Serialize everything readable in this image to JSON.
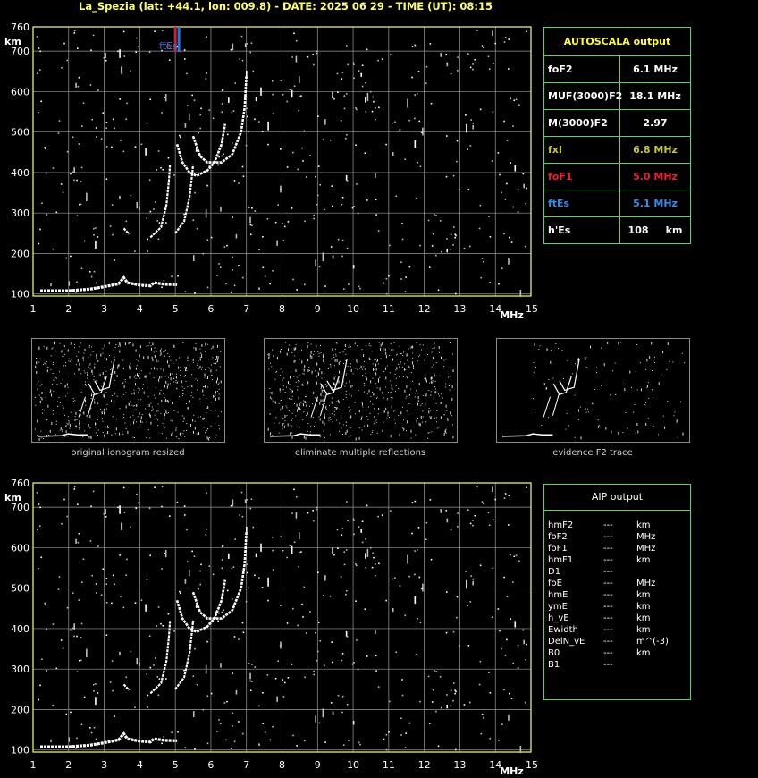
{
  "header": {
    "title": "La_Spezia (lat: +44.1, lon: 009.8) - DATE: 2025 06 29 - TIME (UT): 08:15"
  },
  "ionogram": {
    "y_label": "km",
    "x_label": "MHz",
    "y_ticks": [
      "760",
      "700",
      "600",
      "500",
      "400",
      "300",
      "200",
      "100"
    ],
    "x_ticks": [
      "1",
      "2",
      "3",
      "4",
      "5",
      "6",
      "7",
      "8",
      "9",
      "10",
      "11",
      "12",
      "13",
      "14",
      "15"
    ],
    "marker_label_fo": "fo",
    "marker_label_ftes": "ftEs",
    "colors": {
      "frame": "#ffff66",
      "grid": "#9a9a9a",
      "trace": "#ffffff",
      "fof1_marker": "#d21f2f",
      "ftes_marker": "#1f7be0"
    }
  },
  "autoscala": {
    "title": "AUTOSCALA output",
    "rows": [
      {
        "label": "foF2",
        "value": "6.1 MHz",
        "color": "#ffffff"
      },
      {
        "label": "MUF(3000)F2",
        "value": "18.1 MHz",
        "color": "#ffffff"
      },
      {
        "label": "M(3000)F2",
        "value": "2.97",
        "color": "#ffffff"
      },
      {
        "label": "fxI",
        "value": "6.8 MHz",
        "color": "#c8c832"
      },
      {
        "label": "foF1",
        "value": "5.0 MHz",
        "color": "#e8202f"
      },
      {
        "label": "ftEs",
        "value": "5.1 MHz",
        "color": "#2f8cf0"
      },
      {
        "label": "h'Es",
        "value": "108     km",
        "color": "#ffffff"
      }
    ]
  },
  "thumbnails": [
    {
      "caption": "original ionogram resized"
    },
    {
      "caption": "eliminate multiple reflections"
    },
    {
      "caption": "evidence F2 trace"
    }
  ],
  "aip": {
    "title": "AIP output",
    "rows": [
      {
        "label": "hmF2",
        "dash": "---",
        "unit": "km"
      },
      {
        "label": "foF2",
        "dash": "---",
        "unit": "MHz"
      },
      {
        "label": "foF1",
        "dash": "---",
        "unit": "MHz"
      },
      {
        "label": "hmF1",
        "dash": "---",
        "unit": "km"
      },
      {
        "label": "D1",
        "dash": "---",
        "unit": ""
      },
      {
        "label": "foE",
        "dash": "---",
        "unit": "MHz"
      },
      {
        "label": "hmE",
        "dash": "---",
        "unit": "km"
      },
      {
        "label": "ymE",
        "dash": "---",
        "unit": "km"
      },
      {
        "label": "h_vE",
        "dash": "---",
        "unit": "km"
      },
      {
        "label": "Ewidth",
        "dash": "---",
        "unit": "km"
      },
      {
        "label": "DelN_vE",
        "dash": "---",
        "unit": "m^(-3)"
      },
      {
        "label": "B0",
        "dash": "---",
        "unit": "km"
      },
      {
        "label": "B1",
        "dash": "---",
        "unit": ""
      }
    ]
  }
}
